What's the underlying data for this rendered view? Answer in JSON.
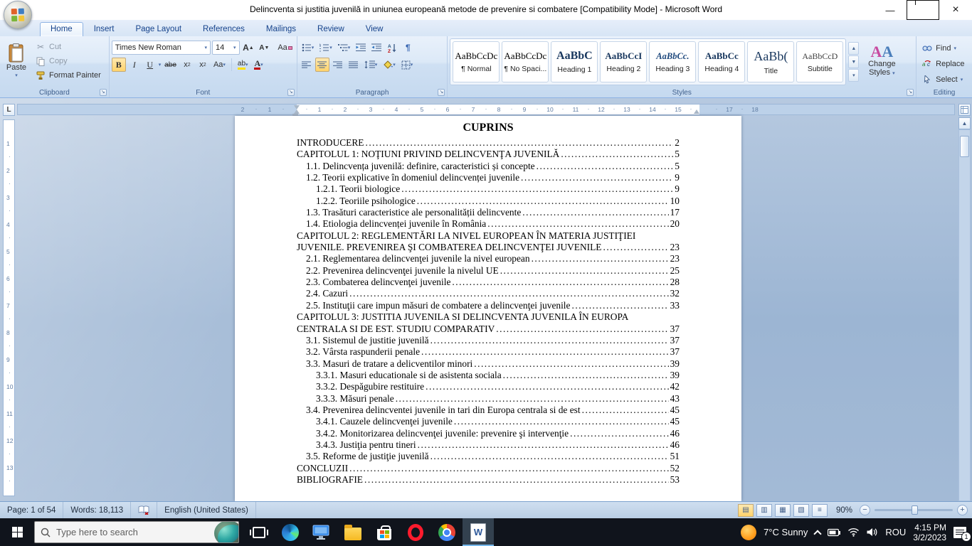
{
  "title_bar": {
    "title": "Delincventa si justitia juvenilă in uniunea europeană metode de prevenire si combatere [Compatibility Mode] - Microsoft Word"
  },
  "ribbon": {
    "tabs": [
      {
        "label": "Home",
        "active": true
      },
      {
        "label": "Insert",
        "active": false
      },
      {
        "label": "Page Layout",
        "active": false
      },
      {
        "label": "References",
        "active": false
      },
      {
        "label": "Mailings",
        "active": false
      },
      {
        "label": "Review",
        "active": false
      },
      {
        "label": "View",
        "active": false
      }
    ],
    "clipboard": {
      "group_label": "Clipboard",
      "paste": "Paste",
      "cut": "Cut",
      "copy": "Copy",
      "format_painter": "Format Painter"
    },
    "font": {
      "group_label": "Font",
      "family": "Times New Roman",
      "size": "14"
    },
    "paragraph": {
      "group_label": "Paragraph"
    },
    "styles": {
      "group_label": "Styles",
      "change_styles_line1": "Change",
      "change_styles_line2": "Styles",
      "items": [
        {
          "sample": "AaBbCcDc",
          "name": "¶ Normal"
        },
        {
          "sample": "AaBbCcDc",
          "name": "¶ No Spaci..."
        },
        {
          "sample": "AaBbC",
          "name": "Heading 1"
        },
        {
          "sample": "AaBbCcI",
          "name": "Heading 2"
        },
        {
          "sample": "AaBbCc.",
          "name": "Heading 3"
        },
        {
          "sample": "AaBbCc",
          "name": "Heading 4"
        },
        {
          "sample": "AaBb(",
          "name": "Title"
        },
        {
          "sample": "AaBbCcD",
          "name": "Subtitle"
        }
      ]
    },
    "editing": {
      "group_label": "Editing",
      "find": "Find",
      "replace": "Replace",
      "select": "Select"
    }
  },
  "ruler": {
    "h_left": [
      "2",
      "1"
    ],
    "h_main": [
      "1",
      "2",
      "3",
      "4",
      "5",
      "6",
      "7",
      "8",
      "9",
      "10",
      "11",
      "12",
      "13",
      "14",
      "15"
    ],
    "h_right": [
      "17",
      "18"
    ],
    "v_main": [
      "1",
      "2",
      "3",
      "4",
      "5",
      "6",
      "7",
      "8",
      "9",
      "10",
      "11",
      "12",
      "13"
    ]
  },
  "document": {
    "title": "CUPRINS",
    "toc": [
      {
        "level": 0,
        "text": "INTRODUCERE",
        "page": "2"
      },
      {
        "level": 0,
        "text": "CAPITOLUL 1: NOŢIUNI PRIVIND DELINCVENŢA JUVENILĂ",
        "page": "5"
      },
      {
        "level": 1,
        "text": "1.1. Delincvența juvenilă: definire, caracteristici și concepte",
        "page": "5"
      },
      {
        "level": 1,
        "text": "1.2. Teorii explicative în domeniul delincvenței juvenile",
        "page": "9"
      },
      {
        "level": 2,
        "text": "1.2.1. Teorii biologice",
        "page": "9"
      },
      {
        "level": 2,
        "text": "1.2.2. Teoriile psihologice",
        "page": "10"
      },
      {
        "level": 1,
        "text": "1.3. Trasături caracteristice ale personalității delincvente",
        "page": "17"
      },
      {
        "level": 1,
        "text": "1.4. Etiologia delincvenței juvenile în România",
        "page": "20"
      },
      {
        "level": 0,
        "text": "CAPITOLUL 2: REGLEMENTĂRI LA NIVEL EUROPEAN ÎN MATERIA JUSTIŢIEI",
        "page": ""
      },
      {
        "level": 0,
        "text": "JUVENILE. PREVENIREA ŞI COMBATEREA DELINCVENŢEI JUVENILE",
        "page": "23"
      },
      {
        "level": 1,
        "text": "2.1. Reglementarea delincvenţei juvenile la nivel european",
        "page": "23"
      },
      {
        "level": 1,
        "text": "2.2. Prevenirea delincvenţei juvenile la nivelul UE",
        "page": "25"
      },
      {
        "level": 1,
        "text": "2.3. Combaterea delincvenţei juvenile",
        "page": "28"
      },
      {
        "level": 1,
        "text": "2.4. Cazuri",
        "page": "32"
      },
      {
        "level": 1,
        "text": "2.5. Instituţii care impun măsuri de combatere a delincvenţei juvenile",
        "page": "33"
      },
      {
        "level": 0,
        "text": "CAPITOLUL 3: JUSTITIA JUVENILA SI DELINCVENTA JUVENILA ÎN EUROPA",
        "page": ""
      },
      {
        "level": 0,
        "text": "CENTRALA SI DE EST. STUDIU COMPARATIV",
        "page": "37"
      },
      {
        "level": 1,
        "text": "3.1. Sistemul de justitie juvenilă",
        "page": "37"
      },
      {
        "level": 1,
        "text": "3.2. Vârsta raspunderii penale",
        "page": "37"
      },
      {
        "level": 1,
        "text": "3.3. Masuri de tratare a delicventilor minori",
        "page": "39"
      },
      {
        "level": 2,
        "text": "3.3.1. Masuri educationale si de asistenta sociala",
        "page": "39"
      },
      {
        "level": 2,
        "text": "3.3.2. Despăgubire restituire",
        "page": "42"
      },
      {
        "level": 2,
        "text": "3.3.3. Măsuri penale",
        "page": "43"
      },
      {
        "level": 1,
        "text": "3.4. Prevenirea delincventei juvenile in tari din Europa centrala si de est",
        "page": "45"
      },
      {
        "level": 2,
        "text": "3.4.1. Cauzele delincvenţei juvenile",
        "page": "45"
      },
      {
        "level": 2,
        "text": "3.4.2. Monitorizarea delincvenţei juvenile: prevenire şi intervenţie",
        "page": "46"
      },
      {
        "level": 2,
        "text": "3.4.3. Justiţia pentru tineri",
        "page": "46"
      },
      {
        "level": 1,
        "text": "3.5. Reforme de justiţie juvenilă",
        "page": "51"
      },
      {
        "level": 0,
        "text": "CONCLUZII",
        "page": "52"
      },
      {
        "level": 0,
        "text": "BIBLIOGRAFIE",
        "page": "53"
      }
    ]
  },
  "status_bar": {
    "page": "Page: 1 of 54",
    "words": "Words: 18,113",
    "language": "English (United States)",
    "zoom_level": "90%"
  },
  "taskbar": {
    "search_placeholder": "Type here to search",
    "weather_temp": "7°C",
    "weather_cond": "Sunny",
    "language": "ROU",
    "time": "4:15 PM",
    "date": "3/2/2023",
    "notification_count": "1"
  }
}
